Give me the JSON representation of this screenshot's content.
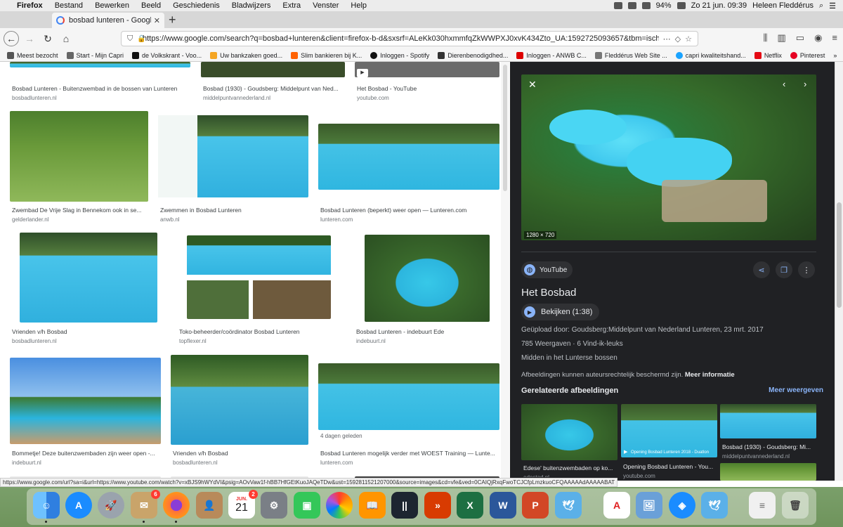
{
  "menubar": {
    "apple": "",
    "app": "Firefox",
    "items": [
      "Bestand",
      "Bewerken",
      "Beeld",
      "Geschiedenis",
      "Bladwijzers",
      "Extra",
      "Venster",
      "Help"
    ],
    "battery": "94%",
    "datetime": "Zo 21 jun. 09:39",
    "user": "Heleen Fleddérus"
  },
  "tab": {
    "title": "bosbad lunteren - Google Zoeken",
    "close": "✕"
  },
  "nav": {
    "url": "https://www.google.com/search?q=bosbad+lunteren&client=firefox-b-d&sxsrf=ALeKk030hxmmfqZkWWPXJ0xvK434Zto_UA:1592725093657&tbm=isch&s"
  },
  "bookmarks": [
    {
      "label": "Meest bezocht",
      "color": "#555"
    },
    {
      "label": "Start - Mijn Capri",
      "color": "#666"
    },
    {
      "label": "de Volkskrant - Voo...",
      "color": "#111"
    },
    {
      "label": "Uw bankzaken goed...",
      "color": "#f5a623"
    },
    {
      "label": "Slim bankieren bij K...",
      "color": "#ff6200"
    },
    {
      "label": "Inloggen - Spotify",
      "color": "#111"
    },
    {
      "label": "Dierenbenodigdhed...",
      "color": "#333"
    },
    {
      "label": "Inloggen - ANWB C...",
      "color": "#d00"
    },
    {
      "label": "Fleddérus Web Site ...",
      "color": "#777"
    },
    {
      "label": "capri kwaliteitshand...",
      "color": "#1aa3ff"
    },
    {
      "label": "Netflix",
      "color": "#e50914"
    },
    {
      "label": "Pinterest",
      "color": "#e60023"
    }
  ],
  "results": [
    {
      "caption": "Bosbad Lunteren - Buitenzwembad in de bossen van Lunteren",
      "source": "bosbadlunteren.nl"
    },
    {
      "caption": "Bosbad (1930) - Goudsberg: Middelpunt van Ned...",
      "source": "middelpuntvannederland.nl"
    },
    {
      "caption": "Het Bosbad - YouTube",
      "source": "youtube.com"
    },
    {
      "caption": "Zwembad De Vrije Slag in Bennekom ook in se...",
      "source": "gelderlander.nl"
    },
    {
      "caption": "Zwemmen in Bosbad Lunteren",
      "source": "anwb.nl"
    },
    {
      "caption": "Bosbad Lunteren (beperkt) weer open — Lunteren.com",
      "source": "lunteren.com"
    },
    {
      "caption": "Vrienden v/h Bosbad",
      "source": "bosbadlunteren.nl"
    },
    {
      "caption": "Toko-beheerder/coördinator Bosbad Lunteren",
      "source": "topflexer.nl"
    },
    {
      "caption": "Bosbad Lunteren - indebuurt Ede",
      "source": "indebuurt.nl"
    },
    {
      "caption": "Bommetje! Deze buitenzwembaden zijn weer open -...",
      "source": "indebuurt.nl"
    },
    {
      "caption": "Vrienden v/h Bosbad",
      "source": "bosbadlunteren.nl"
    },
    {
      "caption": "Bosbad Lunteren mogelijk verder met WOEST Training — Lunte...",
      "source": "lunteren.com"
    }
  ],
  "result_badge": "4 dagen geleden",
  "panel": {
    "dimensions": "1280 × 720",
    "source_name": "YouTube",
    "title": "Het Bosbad",
    "watch": "Bekijken (1:38)",
    "uploaded": "Geüpload door: Goudsberg:Middelpunt van Nederland Lunteren, 23 mrt. 2017",
    "views": "785 Weergaven",
    "likes": "6 Vind-ik-leuks",
    "description": "Midden in het Lunterse bossen",
    "copyright": "Afbeeldingen kunnen auteursrechtelijk beschermd zijn.",
    "more_info": "Meer informatie",
    "related_heading": "Gerelateerde afbeeldingen",
    "related_more": "Meer weergeven",
    "related": [
      {
        "title": "Edese' buitenzwembaden op ko...",
        "source": "edestad.nl"
      },
      {
        "title": "Opening Bosbad Lunteren - You...",
        "source": "youtube.com"
      },
      {
        "title": "Bosbad (1930) - Goudsberg: Mi...",
        "source": "middelpuntvannederland.nl"
      }
    ],
    "related_overlay": "Opening Bosbad Lunteren 2018 - Duatlon"
  },
  "status_url": "https://www.google.com/url?sa=i&url=https://www.youtube.com/watch?v=xBJS9hWYdVI&psig=AOvVaw1f-hBB7HfGEtKuoJAQeTDw&ust=1592811521207000&source=images&cd=vfe&ved=0CAIQjRxqFwoTCJCfpLmzkuoCFQAAAAAdAAAAABAT",
  "dock": {
    "calendar_month": "JUN.",
    "calendar_day": "21",
    "badges": {
      "mail": "6",
      "calendar": "2"
    },
    "apps": [
      "Finder",
      "App Store",
      "Launchpad",
      "Mail",
      "Firefox",
      "Contacts",
      "Calendar",
      "System Preferences",
      "FaceTime",
      "Photos",
      "Books",
      "Parallels",
      "Microsoft Remote Desktop",
      "Excel",
      "Word",
      "PowerPoint",
      "Mikrolern",
      "Acrobat",
      "Preview",
      "Safari",
      "Mikrolern 2",
      "Document",
      "Trash"
    ]
  }
}
